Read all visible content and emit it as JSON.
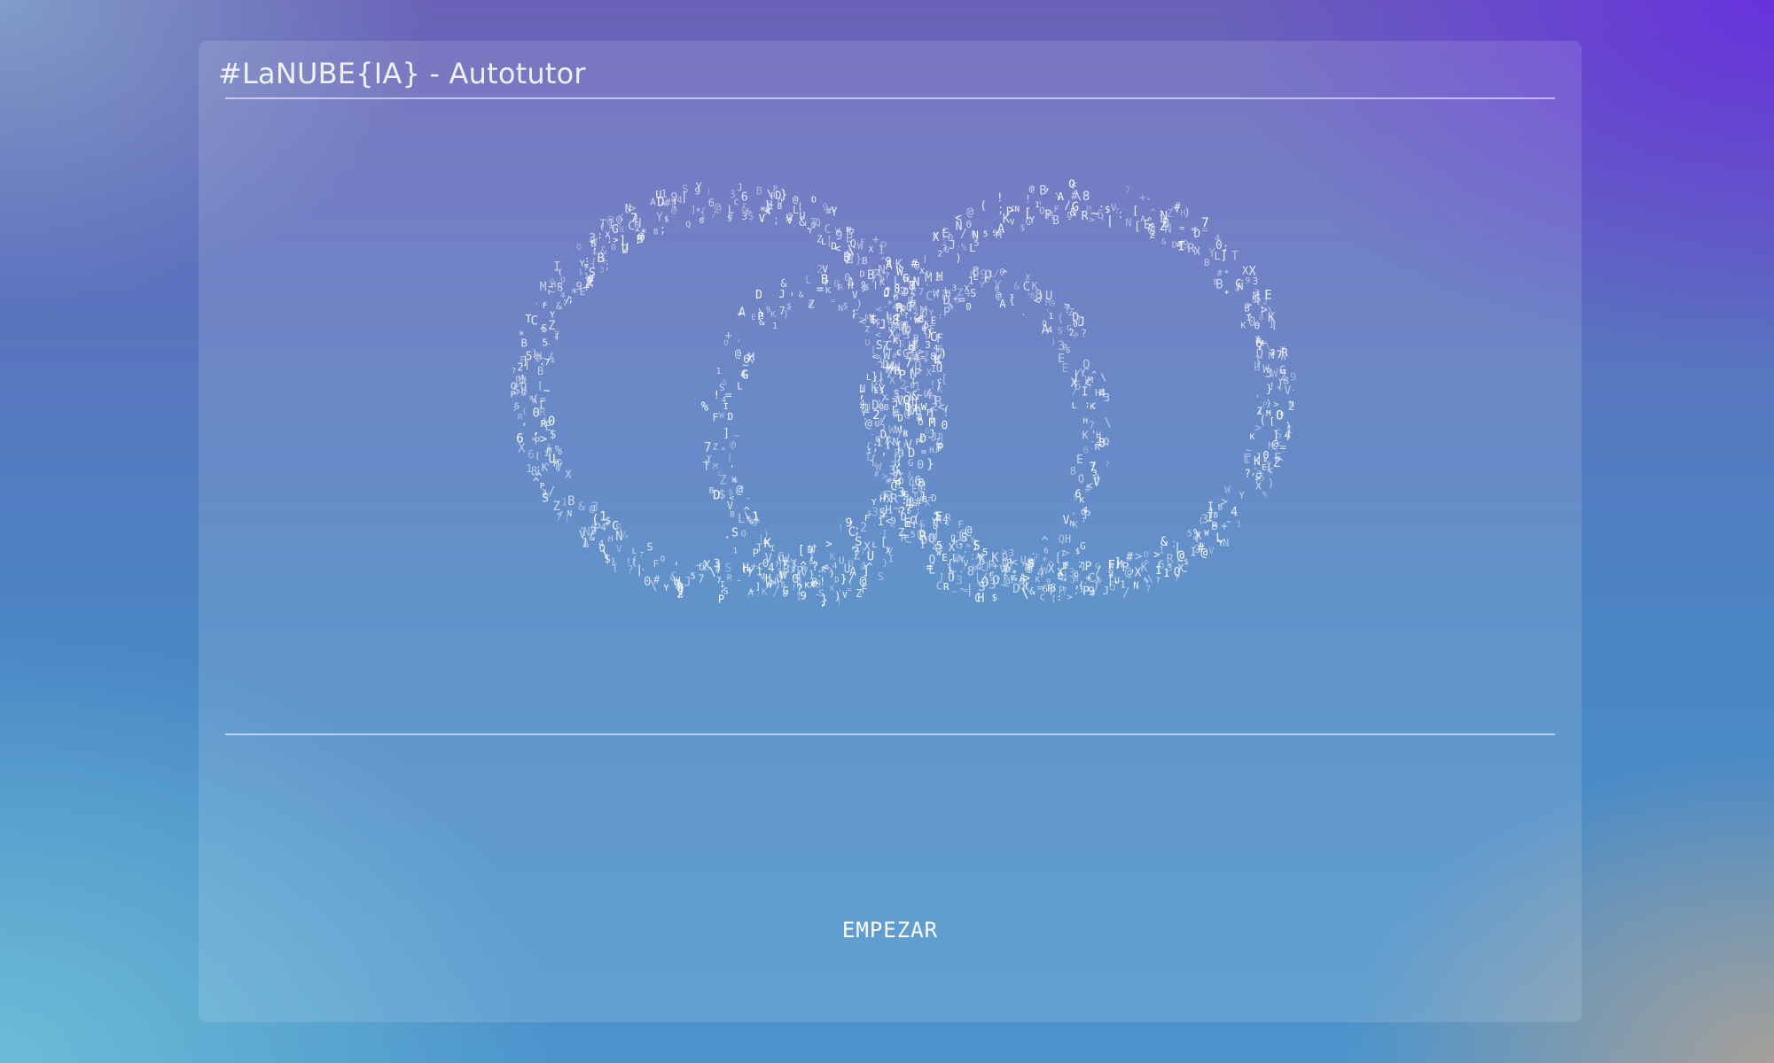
{
  "app": {
    "title": "#LaNUBE{IA} - Autotutor"
  },
  "logo_glyphs": "ABCDEFGHIJKLMNOPQRSTUVWXYZ0123456789#@&$%?![]{}()<>/\\*+-=;:.,'^~|",
  "start_button": {
    "label": "EMPEZAR"
  },
  "colors": {
    "glyph": "#ffffff",
    "rule": "rgba(255,255,255,0.55)"
  }
}
